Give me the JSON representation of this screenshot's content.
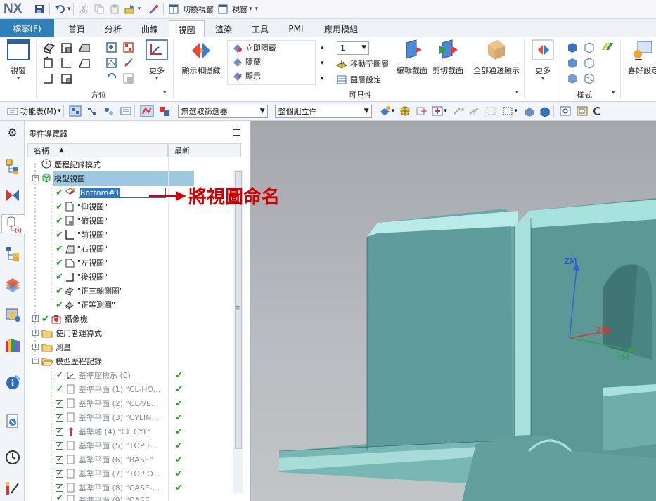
{
  "app": {
    "logo": "NX"
  },
  "quick_access": {
    "switch_window": "切換視窗",
    "window": "視窗"
  },
  "tabs": {
    "file": "檔案(F)",
    "items": [
      {
        "label": "首頁"
      },
      {
        "label": "分析"
      },
      {
        "label": "曲線"
      },
      {
        "label": "視圖",
        "active": true
      },
      {
        "label": "渲染"
      },
      {
        "label": "工具"
      },
      {
        "label": "PMI"
      },
      {
        "label": "應用模組"
      }
    ]
  },
  "ribbon": {
    "view_btn": "視窗",
    "orient_group": "方位",
    "more1": "更多",
    "show_hide": "顯示和隱藏",
    "instant_hide": "立即隱藏",
    "hide": "隱藏",
    "show": "顯示",
    "layer_value": "1",
    "move_to_layer": "移動至圖層",
    "layer_settings": "圖層設定",
    "visibility_group": "可見性",
    "edit_section": "編輯截面",
    "clip_section": "剪切截面",
    "show_all": "全部通透顯示",
    "more2": "更多",
    "style_group": "樣式",
    "preferences": "喜好設定"
  },
  "cmdbar": {
    "menu": "功能表(M)",
    "filter": "無選取篩選器",
    "scope": "整個組立件"
  },
  "navigator": {
    "title": "零件導覽器",
    "col_name": "名稱",
    "col_latest": "最新",
    "rows": [
      {
        "label": "歷程記錄模式"
      },
      {
        "label": "模型視圖"
      },
      {
        "label": "Bottom#1"
      },
      {
        "label": "\"仰視圖\""
      },
      {
        "label": "\"俯視圖\""
      },
      {
        "label": "\"前視圖\""
      },
      {
        "label": "\"右視圖\""
      },
      {
        "label": "\"左視圖\""
      },
      {
        "label": "\"後視圖\""
      },
      {
        "label": "\"正三軸測圖\""
      },
      {
        "label": "\"正等測圖\""
      },
      {
        "label": "攝像機"
      },
      {
        "label": "使用者運算式"
      },
      {
        "label": "測量"
      },
      {
        "label": "模型歷程記錄"
      },
      {
        "label": "基準座標系 (0)"
      },
      {
        "label": "基準平面 (1) \"CL-HO..."
      },
      {
        "label": "基準平面 (2) \"CL-VE..."
      },
      {
        "label": "基準平面 (3) \"CYLIN..."
      },
      {
        "label": "基準軸 (4) \"CL CYL\""
      },
      {
        "label": "基準平面 (5) \"TOP F..."
      },
      {
        "label": "基準平面 (6) \"BASE\""
      },
      {
        "label": "基準平面 (7) \"TOP O..."
      },
      {
        "label": "基準平面 (8) \"CASE-..."
      },
      {
        "label": "基準平面 (9) \"CASE..."
      }
    ]
  },
  "viewport": {
    "axis_z": "ZM",
    "axis_x": "XM",
    "axis_y": "YM"
  },
  "annotation": {
    "text": "將視圖命名"
  }
}
